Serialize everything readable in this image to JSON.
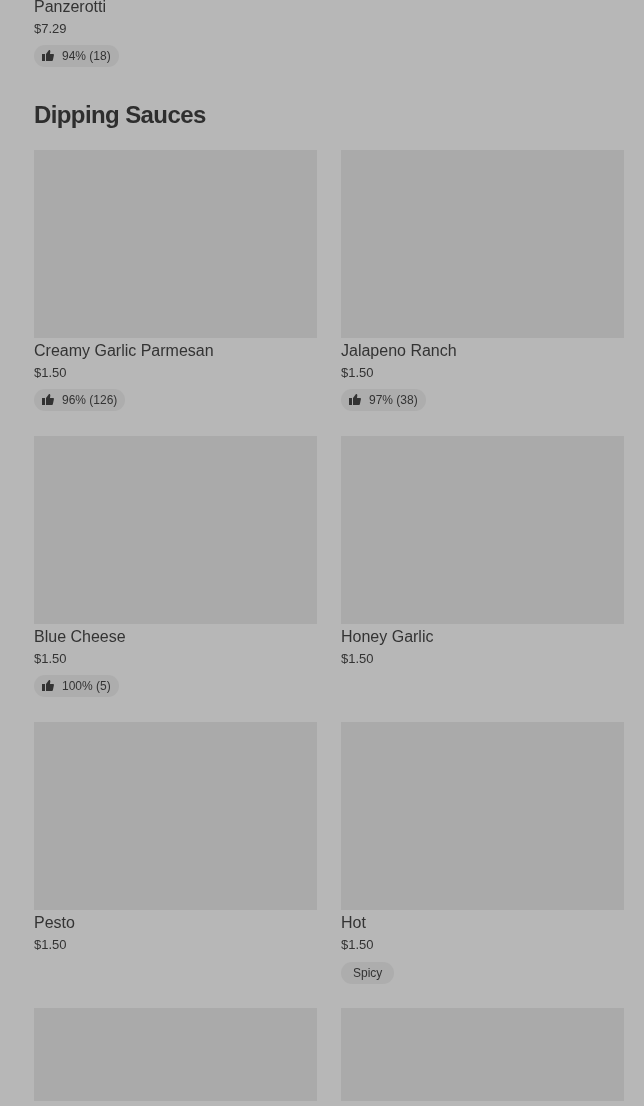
{
  "previous_item": {
    "name": "Panzerotti",
    "price": "$7.29",
    "badge": {
      "kind": "rating",
      "text": "94% (18)"
    }
  },
  "section": {
    "title": "Dipping Sauces",
    "items": [
      {
        "name": "Creamy Garlic Parmesan",
        "price": "$1.50",
        "badge": {
          "kind": "rating",
          "text": "96% (126)"
        }
      },
      {
        "name": "Jalapeno Ranch",
        "price": "$1.50",
        "badge": {
          "kind": "rating",
          "text": "97% (38)"
        }
      },
      {
        "name": "Blue Cheese",
        "price": "$1.50",
        "badge": {
          "kind": "rating",
          "text": "100% (5)"
        }
      },
      {
        "name": "Honey Garlic",
        "price": "$1.50"
      },
      {
        "name": "Pesto",
        "price": "$1.50"
      },
      {
        "name": "Hot",
        "price": "$1.50",
        "badge": {
          "kind": "tag",
          "text": "Spicy"
        }
      },
      {
        "kind": "image_only"
      },
      {
        "kind": "image_only"
      }
    ]
  }
}
